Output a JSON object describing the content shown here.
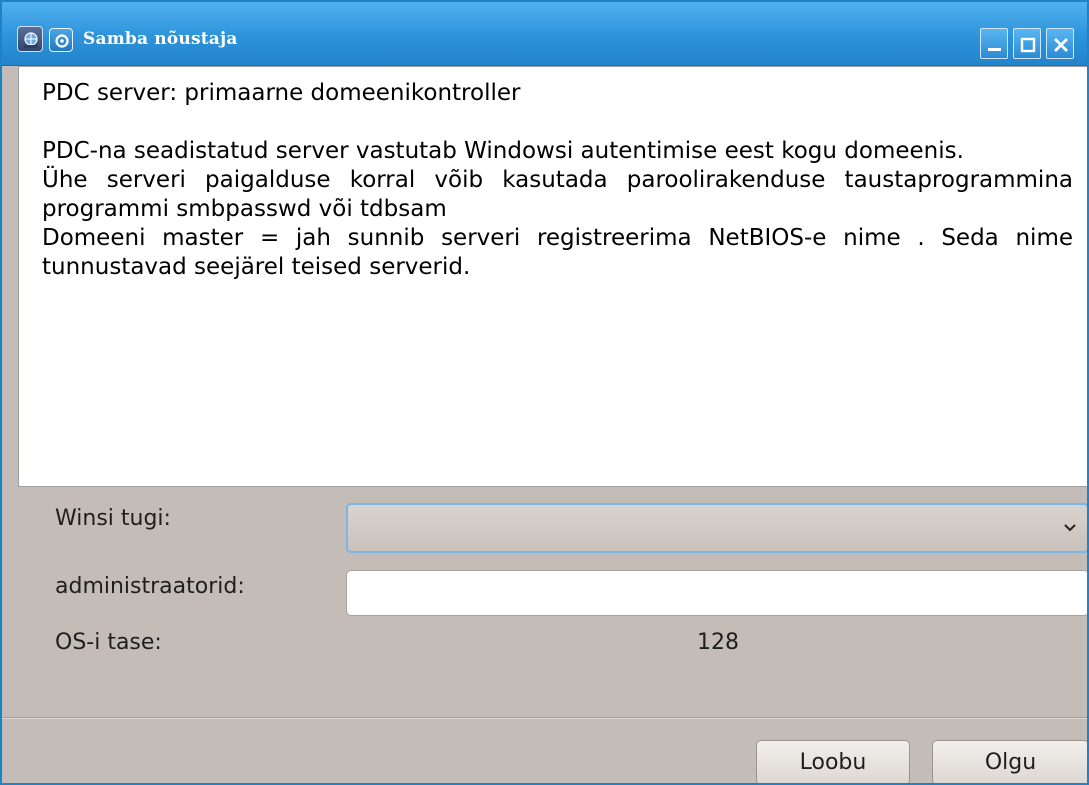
{
  "window": {
    "title": "Samba nõustaja",
    "app_icon": "samba-network-icon",
    "menu_icon": "window-menu-icon",
    "controls": [
      "minimize-icon",
      "maximize-icon",
      "close-icon"
    ]
  },
  "description": {
    "heading": "PDC server: primaarne domeenikontroller",
    "paragraphs": [
      "PDC-na seadistatud server vastutab Windowsi autentimise eest kogu domeenis.",
      "Ühe serveri paigalduse korral võib kasutada paroolirakenduse taustaprogrammina programmi smbpasswd või tdbsam",
      "Domeeni master = jah sunnib serveri registreerima NetBIOS-e nime . Seda nime tunnustavad seejärel teised serverid."
    ]
  },
  "form": {
    "wins_label": "Winsi tugi:",
    "wins_value": "",
    "admins_label": "administraatorid:",
    "admins_value": "",
    "os_level_label": "OS-i tase:",
    "os_level_value": "128"
  },
  "buttons": {
    "cancel": "Loobu",
    "ok": "Olgu"
  },
  "colors": {
    "titlebar": "#2d93da",
    "dialog_bg": "#c4bcb6",
    "focus_border": "#7ab6e6"
  }
}
